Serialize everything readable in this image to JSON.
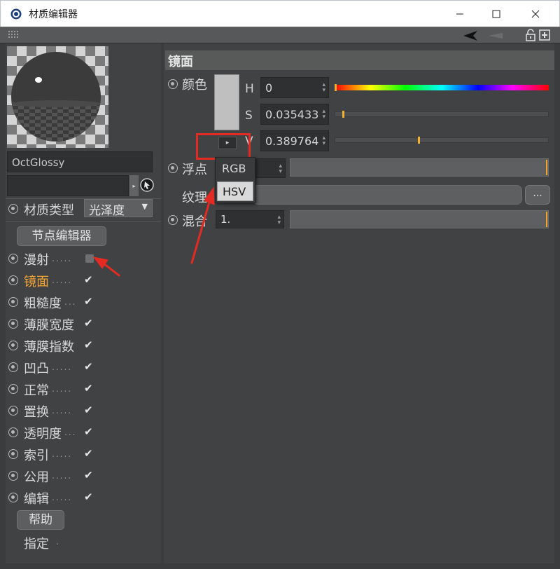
{
  "window": {
    "title": "材质编辑器"
  },
  "material": {
    "name": "OctGlossy",
    "type_label": "材质类型",
    "type_value": "光泽度",
    "node_editor_label": "节点编辑器",
    "help_label": "帮助",
    "assign_label": "指定"
  },
  "channels": [
    {
      "label": "漫射",
      "dots": ".....",
      "checked": false,
      "active": false
    },
    {
      "label": "镜面",
      "dots": ".....",
      "checked": true,
      "active": true
    },
    {
      "label": "粗糙度",
      "dots": "...",
      "checked": true,
      "active": false
    },
    {
      "label": "薄膜宽度",
      "dots": "",
      "checked": true,
      "active": false
    },
    {
      "label": "薄膜指数",
      "dots": "",
      "checked": true,
      "active": false
    },
    {
      "label": "凹凸",
      "dots": ".....",
      "checked": true,
      "active": false
    },
    {
      "label": "正常",
      "dots": ".....",
      "checked": true,
      "active": false
    },
    {
      "label": "置换",
      "dots": ".....",
      "checked": true,
      "active": false
    },
    {
      "label": "透明度",
      "dots": "...",
      "checked": true,
      "active": false
    },
    {
      "label": "索引",
      "dots": ".....",
      "checked": true,
      "active": false
    },
    {
      "label": "公用",
      "dots": ".....",
      "checked": true,
      "active": false
    },
    {
      "label": "编辑",
      "dots": ".....",
      "checked": true,
      "active": false
    }
  ],
  "specular": {
    "section_title": "镜面",
    "color_label": "颜色",
    "h_label": "H",
    "h_value": "0",
    "s_label": "S",
    "s_value": "0.035433",
    "v_label": "V",
    "v_value": "0.389764",
    "h_fraction": 0.0,
    "s_fraction": 0.035433,
    "v_fraction": 0.389764,
    "float_label": "浮点",
    "texture_label": "纹理",
    "texture_button": "...",
    "mix_label": "混合",
    "mix_value": "1."
  },
  "color_mode_menu": {
    "options": [
      "RGB",
      "HSV"
    ],
    "highlighted": "HSV"
  },
  "colors": {
    "accent": "#f2a533",
    "annotation_red": "#e42b23"
  }
}
